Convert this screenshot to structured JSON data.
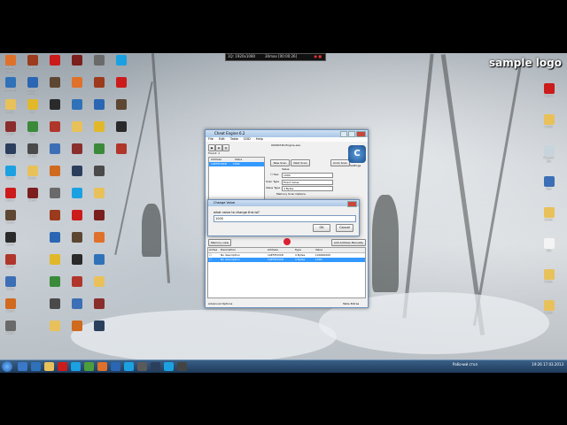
{
  "topbar": {
    "left": "1Q:  1920x1080",
    "right": "30max  [00:00:26]"
  },
  "logo": {
    "text": "sample logo"
  },
  "desktop": {
    "left_icons": [
      {
        "label": "Mozilla Firefox",
        "color": "#e0712a"
      },
      {
        "label": "Photoshop",
        "color": "#2f72b8"
      },
      {
        "label": "Folder",
        "color": "#e8c15a"
      },
      {
        "label": "Game",
        "color": "#8a2d2d"
      },
      {
        "label": "Steam",
        "color": "#2b3f5c"
      },
      {
        "label": "Skype",
        "color": "#1ba1e2"
      },
      {
        "label": "Opera",
        "color": "#cc1b1b"
      },
      {
        "label": "Game",
        "color": "#5d4632"
      },
      {
        "label": "Game",
        "color": "#2a2a2a"
      },
      {
        "label": "Game",
        "color": "#b0362b"
      },
      {
        "label": "Utility",
        "color": "#3c6fb5"
      },
      {
        "label": "Game",
        "color": "#d06a1f"
      },
      {
        "label": "Game",
        "color": "#6a6a6a"
      },
      {
        "label": "Game",
        "color": "#9b3a1c"
      },
      {
        "label": "Cheat Engine",
        "color": "#2a66b3"
      },
      {
        "label": "App",
        "color": "#e1b82a"
      },
      {
        "label": "App",
        "color": "#3a8a3a"
      },
      {
        "label": "Game",
        "color": "#4a4a4a"
      },
      {
        "label": "Folder",
        "color": "#e8c15a"
      },
      {
        "label": "Game",
        "color": "#7b1e1e"
      }
    ],
    "right_icons": [
      {
        "label": "Opera",
        "color": "#cc1b1b"
      },
      {
        "label": "Folder",
        "color": "#e8c15a"
      },
      {
        "label": "Recycle Bin",
        "color": "#c8d4dc"
      },
      {
        "label": "App",
        "color": "#3b6fb6"
      },
      {
        "label": "Folder",
        "color": "#e8c15a"
      },
      {
        "label": "File",
        "color": "#f4f4f4"
      },
      {
        "label": "Folder",
        "color": "#e8c15a"
      },
      {
        "label": "Folder",
        "color": "#e8c15a"
      }
    ]
  },
  "cheat_engine": {
    "title": "Cheat Engine 6.2",
    "menu": [
      "File",
      "Edit",
      "Table",
      "D3D",
      "Help"
    ],
    "process": "00000740-Engine.exe",
    "found": "Found: 1",
    "addr_header": [
      "Address",
      "Value"
    ],
    "addr_rows": [
      {
        "address": "1AE5FCDC8",
        "value": "1000"
      }
    ],
    "buttons": {
      "new_scan": "New Scan",
      "next_scan": "Next Scan",
      "undo_scan": "Undo Scan",
      "settings": "Settings"
    },
    "value_label": "Value:",
    "hex_label": "Hex",
    "value_input": "1000",
    "scan_type_label": "Scan Type",
    "scan_type": "Exact Value",
    "value_type_label": "Value Type",
    "value_type": "4 Bytes",
    "memory_scan": "Memory Scan Options",
    "memory_view": "Memory view",
    "add_address": "Add Address Manually",
    "table_header": [
      "Active",
      "Description",
      "Address",
      "Type",
      "Value"
    ],
    "table_rows": [
      {
        "description": "No description",
        "address": "1AE5FCDC8",
        "type": "4 Bytes",
        "value": "100000000",
        "selected": false
      },
      {
        "description": "No description",
        "address": "1AE5FCDC8",
        "type": "4 Bytes",
        "value": "1000",
        "selected": true
      }
    ],
    "advanced": "Advanced Options",
    "table_extras": "Table Extras"
  },
  "dialog": {
    "title": "Change Value",
    "message": "what value to change this to?",
    "value": "1000",
    "ok": "OK",
    "cancel": "Cancel"
  },
  "taskbar": {
    "apps": [
      "#3a78c8",
      "#2f72b8",
      "#e8c15a",
      "#cc1b1b",
      "#1ba1e2",
      "#4b9e3c",
      "#e0712a",
      "#2a66b3",
      "#1ba1e2",
      "#5a5a5a",
      "#2b3f5c",
      "#1ba1e2",
      "#444444"
    ],
    "tray_text": "Рабочий стол",
    "time": "19:26",
    "date": "17.03.2013"
  }
}
